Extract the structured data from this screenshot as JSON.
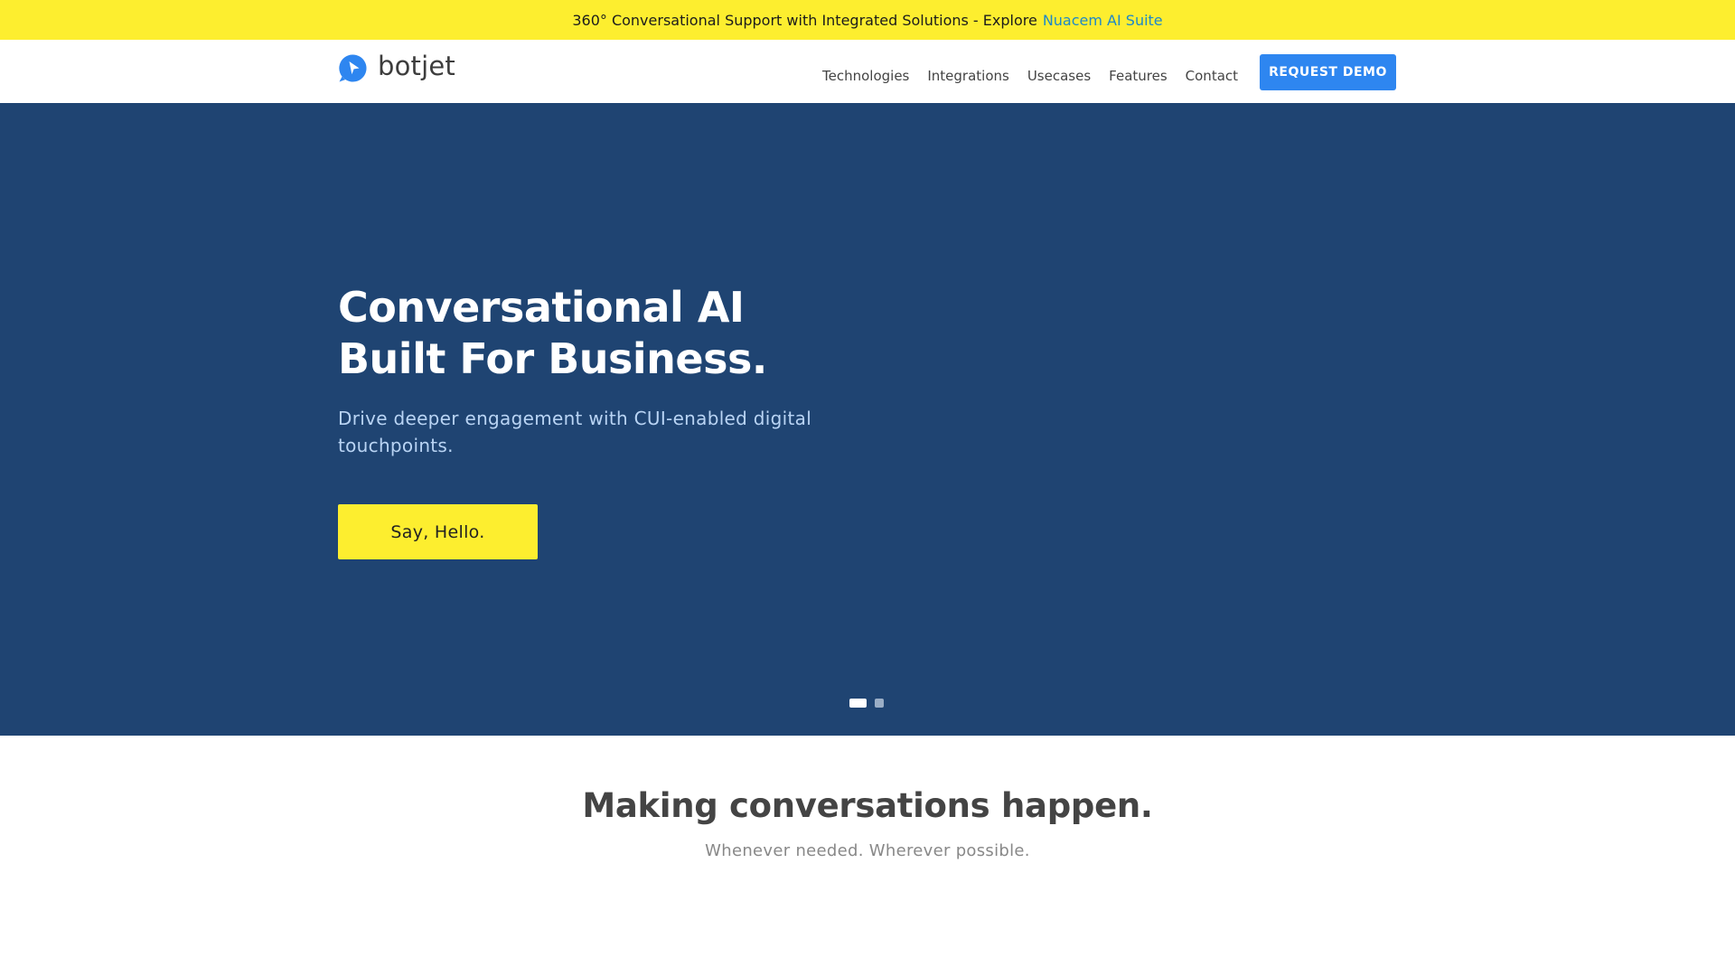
{
  "announcement": {
    "text": "360° Conversational Support with Integrated Solutions - Explore",
    "link_label": "Nuacem AI Suite"
  },
  "header": {
    "logo_text": "botjet",
    "logo_icon": "chat-bubble-arrow-icon",
    "nav": [
      {
        "label": "Technologies"
      },
      {
        "label": "Integrations"
      },
      {
        "label": "Usecases"
      },
      {
        "label": "Features"
      },
      {
        "label": "Contact"
      }
    ],
    "cta_label": "REQUEST DEMO"
  },
  "hero": {
    "title_line1": "Conversational AI",
    "title_line2": "Built For Business.",
    "subtitle": "Drive deeper engagement with CUI-enabled digital touchpoints.",
    "button_label": "Say, Hello.",
    "slides": {
      "count": 2,
      "active_index": 0
    }
  },
  "section": {
    "title": "Making conversations happen.",
    "subtitle": "Whenever needed. Wherever possible."
  },
  "colors": {
    "announcement_bg": "#fdee2f",
    "link": "#1e88c8",
    "hero_bg": "#1f4472",
    "cta_blue": "#2e86f0",
    "hello_button": "#fdee2f"
  }
}
